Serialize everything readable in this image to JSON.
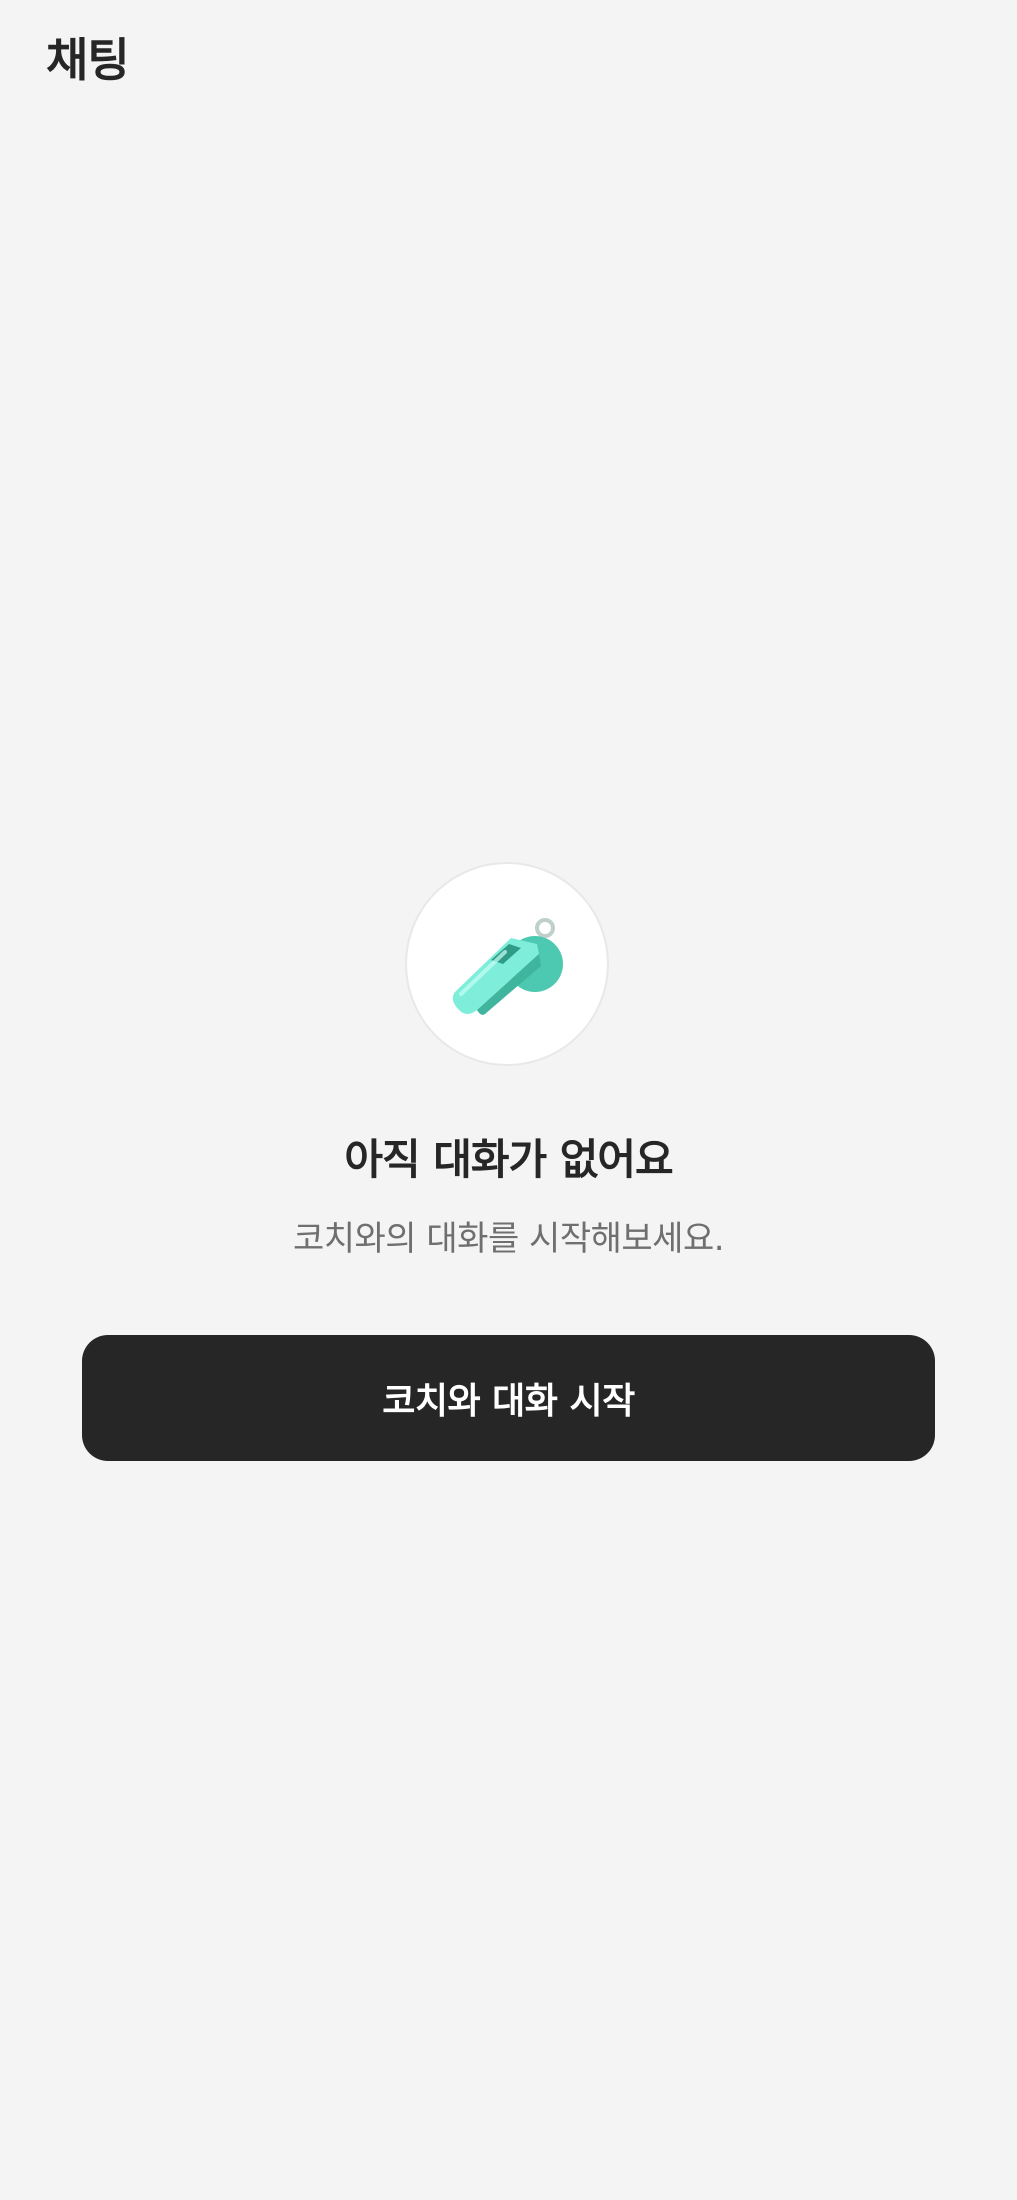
{
  "header": {
    "title": "채팅"
  },
  "empty_state": {
    "icon": "whistle-icon",
    "title": "아직 대화가 없어요",
    "subtitle": "코치와의 대화를 시작해보세요.",
    "button_label": "코치와 대화 시작"
  },
  "colors": {
    "background": "#f4f4f4",
    "button": "#262626",
    "button_text": "#ffffff",
    "whistle": "#5ed6c0",
    "subtitle_text": "#6f6f6f"
  }
}
